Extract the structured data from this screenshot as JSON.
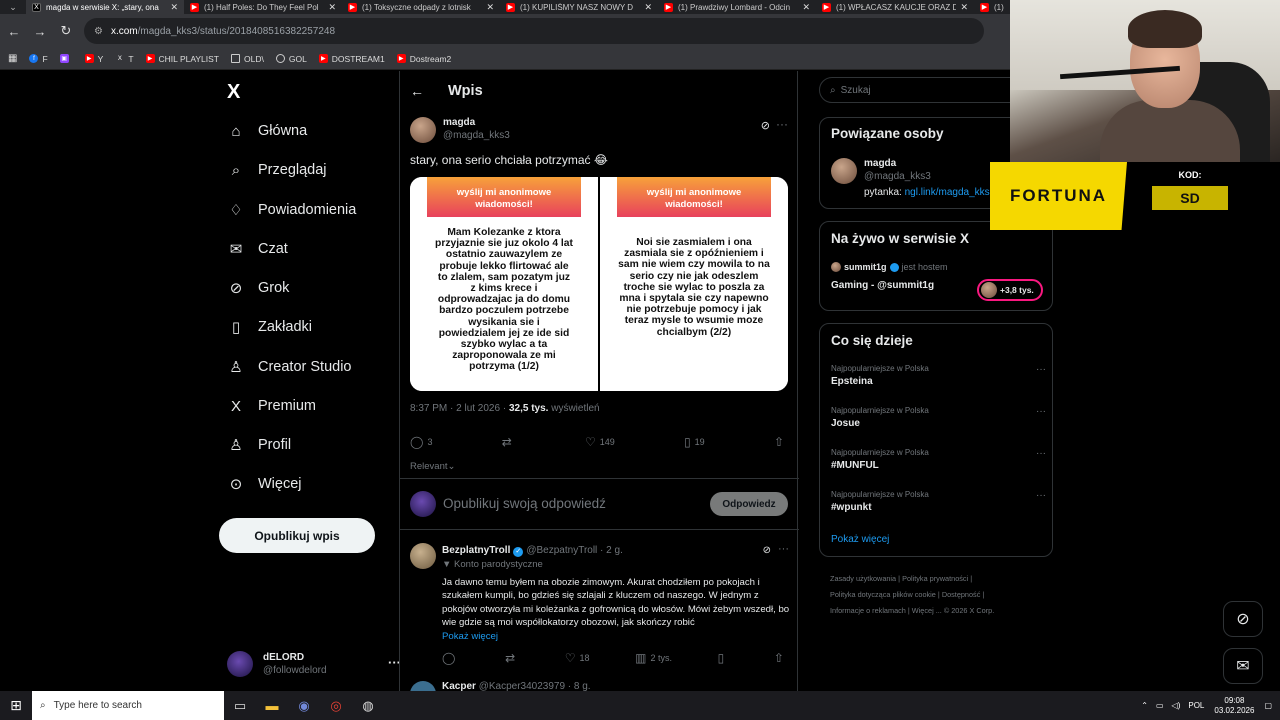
{
  "browser": {
    "tabs": [
      {
        "label": "magda w serwisie X: „stary, ona",
        "icon": "x-logo-icon",
        "active": true
      },
      {
        "label": "(1) Half Poles: Do They Feel Pol",
        "icon": "youtube-icon"
      },
      {
        "label": "(1) Toksyczne odpady z lotnisk",
        "icon": "youtube-icon"
      },
      {
        "label": "(1) KUPILIŚMY NASZ NOWY D",
        "icon": "youtube-icon"
      },
      {
        "label": "(1) Prawdziwy Lombard - Odcin",
        "icon": "youtube-icon"
      },
      {
        "label": "(1) WPŁACASZ KAUCJE ORAZ D",
        "icon": "youtube-icon"
      },
      {
        "label": "(1)",
        "icon": "youtube-icon"
      }
    ],
    "url_domain": "x.com",
    "url_path": "/magda_kks3/status/2018408516382257248",
    "bookmarks": [
      {
        "label": "F",
        "icon": "facebook-icon"
      },
      {
        "label": "",
        "icon": "twitch-icon"
      },
      {
        "label": "Y",
        "icon": "youtube-icon"
      },
      {
        "label": "T",
        "icon": "x-logo-icon"
      },
      {
        "label": "CHIL PLAYLIST",
        "icon": "youtube-icon"
      },
      {
        "label": "OLD\\",
        "icon": "folder-icon"
      },
      {
        "label": "GOL",
        "icon": "globe-icon"
      },
      {
        "label": "DOSTREAM1",
        "icon": "youtube-icon"
      },
      {
        "label": "Dostream2",
        "icon": "youtube-icon"
      }
    ]
  },
  "nav": {
    "logo": "X",
    "items": [
      {
        "label": "Główna",
        "icon": "home-icon"
      },
      {
        "label": "Przeglądaj",
        "icon": "search-icon"
      },
      {
        "label": "Powiadomienia",
        "icon": "bell-icon"
      },
      {
        "label": "Czat",
        "icon": "mail-icon"
      },
      {
        "label": "Grok",
        "icon": "grok-icon"
      },
      {
        "label": "Zakładki",
        "icon": "bookmark-icon"
      },
      {
        "label": "Creator Studio",
        "icon": "creator-icon"
      },
      {
        "label": "Premium",
        "icon": "x-logo-icon"
      },
      {
        "label": "Profil",
        "icon": "person-icon"
      },
      {
        "label": "Więcej",
        "icon": "more-circle-icon"
      }
    ],
    "post_button": "Opublikuj wpis",
    "user": {
      "name": "dELORD",
      "handle": "@followdelord"
    }
  },
  "center": {
    "header": "Wpis",
    "tweet": {
      "name": "magda",
      "handle": "@magda_kks3",
      "text": "stary, ona serio chciała potrzymać 😂",
      "story_left_banner": "wyślij mi anonimowe wiadomości!",
      "story_left_body": "Mam Kolezanke z ktora przyjaznie sie juz okolo 4 lat ostatnio zauwazylem ze probuje lekko flirtować ale to zlalem, sam pozatym juz z kims krece i odprowadzajac ja do domu bardzo poczulem potrzebe wysikania sie i powiedzialem jej ze ide sid szybko wylac a ta zaproponowala ze mi potrzyma (1/2)",
      "story_right_banner": "wyślij mi anonimowe wiadomości!",
      "story_right_body": "Noi sie zasmialem i ona zasmiala sie z opóźnieniem i sam nie wiem czy mowila to na serio czy nie jak odeszlem troche sie wylac to poszla za mna i spytala sie czy napewno nie potrzebuje pomocy i jak teraz mysle to wsumie moze chcialbym (2/2)",
      "time": "8:37 PM · 2 lut 2026 ·",
      "views": "32,5 tys.",
      "views_label": "wyświetleń",
      "replies": "3",
      "retweets": "",
      "likes": "149",
      "bookmarks": "19",
      "sort_label": "Relevant"
    },
    "reply_box": {
      "placeholder": "Opublikuj swoją odpowiedź",
      "button": "Odpowiedz"
    },
    "replies": [
      {
        "name": "BezplatnyTroll",
        "handle": "@BezpatnyTroll · 2 g.",
        "parody": "Konto parodystyczne",
        "text": "Ja dawno temu byłem na obozie zimowym. Akurat chodziłem po pokojach i szukałem kumpli, bo gdzieś się szlajali z kluczem od naszego. W jednym z pokojów otworzyła mi koleżanka z gofrownicą do włosów. Mówi żebym wszedł, bo wie gdzie są moi współlokatorzy obozowi, jak skończy robić",
        "show_more": "Pokaż więcej",
        "replies": "",
        "retweets": "",
        "likes": "18",
        "views": "2 tys."
      },
      {
        "name": "Kacper",
        "handle": "@Kacper34023979 · 8 g."
      }
    ]
  },
  "right": {
    "search_placeholder": "Szukaj",
    "related_title": "Powiązane osoby",
    "related": {
      "name": "magda",
      "handle": "@magda_kks3",
      "bio_prefix": "pytanka:",
      "bio_link": "ngl.link/magda_kks3"
    },
    "live_title": "Na żywo w serwisie X",
    "live": {
      "host": "summit1g",
      "host_label": "jest hostem",
      "title": "Gaming - @summit1g",
      "listeners": "+3,8 tys."
    },
    "trends_title": "Co się dzieje",
    "trends": [
      {
        "context": "Najpopularniejsze w Polska",
        "name": "Epsteina"
      },
      {
        "context": "Najpopularniejsze w Polska",
        "name": "Josue"
      },
      {
        "context": "Najpopularniejsze w Polska",
        "name": "#MUNFUL"
      },
      {
        "context": "Najpopularniejsze w Polska",
        "name": "#wpunkt"
      }
    ],
    "show_more": "Pokaż więcej",
    "footer_links": [
      "Zasady użytkowania",
      "Polityka prywatności",
      "Polityka dotycząca plików cookie",
      "Dostępność",
      "Informacje o reklamach",
      "Więcej ...",
      "© 2026 X Corp."
    ]
  },
  "overlay": {
    "sponsor": "FORTUNA",
    "code_label": "KOD:",
    "code_value": "SD"
  },
  "taskbar": {
    "search_placeholder": "Type here to search",
    "lang": "POL",
    "time": "09:08",
    "date": "03.02.2026"
  }
}
